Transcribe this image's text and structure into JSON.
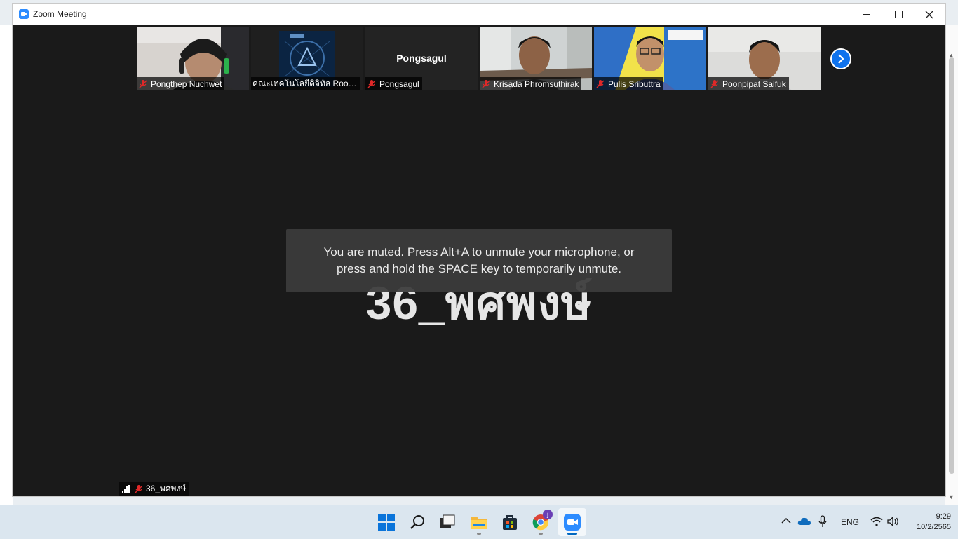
{
  "window": {
    "title": "Zoom Meeting"
  },
  "gallery": {
    "tiles": [
      {
        "name": "Pongthep Nuchwet",
        "muted": true,
        "has_video": true
      },
      {
        "name": "คณะเทคโนโลยีดิจิทัล Room ...",
        "muted": false,
        "has_video": true
      },
      {
        "name": "Pongsagul",
        "center_name": "Pongsagul",
        "muted": true,
        "has_video": false
      },
      {
        "name": "Krisada Phromsuthirak",
        "muted": true,
        "has_video": true
      },
      {
        "name": "Pulis Sributtra",
        "muted": true,
        "has_video": true
      },
      {
        "name": "Poonpipat Saifuk",
        "muted": true,
        "has_video": true
      }
    ]
  },
  "main": {
    "speaker_name": "36_พศพงษ์",
    "toast_line1": "You are muted. Press Alt+A to unmute your microphone, or",
    "toast_line2": "press and hold the SPACE key to temporarily unmute."
  },
  "self_view": {
    "name": "36_พศพงษ์"
  },
  "taskbar": {
    "language": "ENG",
    "time": "9:29",
    "date": "10/2/2565",
    "chrome_badge": "j"
  },
  "colors": {
    "accent": "#0e72ed",
    "muted_mic": "#e02828",
    "window_bg": "#1a1a1a"
  }
}
